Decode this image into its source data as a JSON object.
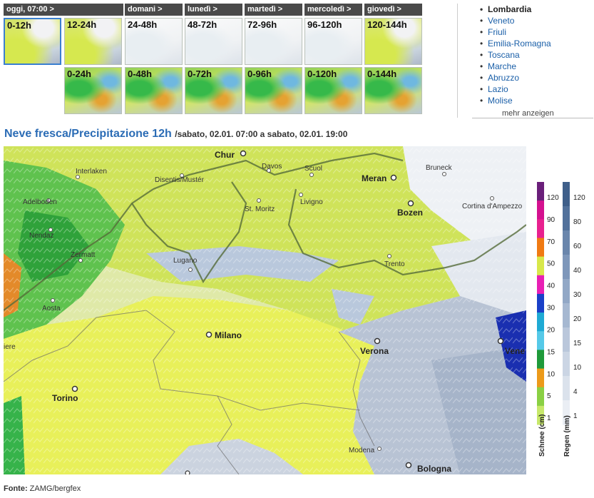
{
  "tabs": {
    "days": [
      "oggi, 07:00 >",
      "domani >",
      "lunedì >",
      "martedì >",
      "mercoledì >",
      "giovedì >"
    ],
    "row1": [
      "0-12h",
      "12-24h",
      "24-48h",
      "48-72h",
      "72-96h",
      "96-120h",
      "120-144h"
    ],
    "row2": [
      "0-24h",
      "0-48h",
      "0-72h",
      "0-96h",
      "0-120h",
      "0-144h"
    ]
  },
  "regions": {
    "items": [
      "Lombardia",
      "Veneto",
      "Friuli",
      "Emilia-Romagna",
      "Toscana",
      "Marche",
      "Abruzzo",
      "Lazio",
      "Molise"
    ],
    "more": "mehr anzeigen"
  },
  "title": {
    "main": "Neve fresca/Precipitazione 12h",
    "sub": "/sabato, 02.01. 07:00 a sabato, 02.01. 19:00"
  },
  "map": {
    "cities": [
      "Chur",
      "Meran",
      "Bozen",
      "Milano",
      "Verona",
      "Vene",
      "Torino",
      "Bologna"
    ],
    "towns": [
      "Interlaken",
      "Davos",
      "Scuol",
      "Bruneck",
      "Disentis/Mustér",
      "Adelboden",
      "St. Moritz",
      "Livigno",
      "Cortina d'Ampezzo",
      "Nendaz",
      "Zermatt",
      "Lugano",
      "Trento",
      "Aosta",
      "Modena",
      "iere"
    ]
  },
  "legend": {
    "snow_title": "Schnee (cm)",
    "rain_title": "Regen (mm)",
    "snow_levels": [
      "120",
      "90",
      "70",
      "50",
      "40",
      "30",
      "20",
      "15",
      "10",
      "5",
      "1"
    ],
    "rain_levels": [
      "120",
      "80",
      "60",
      "40",
      "30",
      "20",
      "15",
      "10",
      "4",
      "1"
    ],
    "snow_colors": [
      "#6a1f7a",
      "#d4118f",
      "#e8218f",
      "#f07a13",
      "#d8e84a",
      "#e81fb4",
      "#1a40c8",
      "#1faad4",
      "#56c9e8",
      "#1f9a3a",
      "#ec9a1a",
      "#8ad044",
      "#c7e86a"
    ],
    "rain_colors": [
      "#3f5f8a",
      "#52719b",
      "#6a86ac",
      "#7e97ba",
      "#92a8c6",
      "#a6b8d1",
      "#bac7db",
      "#cbd5e4",
      "#dbe2ec",
      "#eaeef4"
    ]
  },
  "footer": {
    "label": "Fonte:",
    "source": "ZAMG/bergfex"
  }
}
